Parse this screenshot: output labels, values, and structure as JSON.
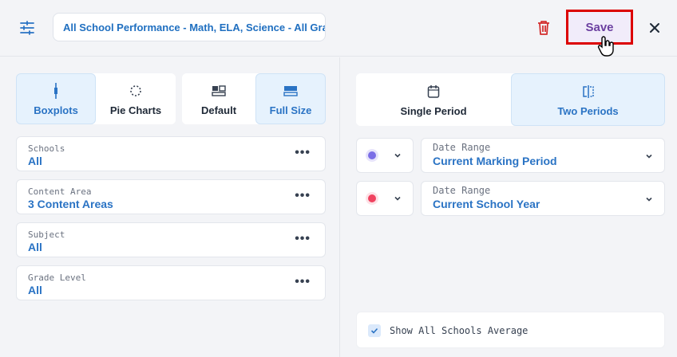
{
  "header": {
    "title_value": "All School Performance - Math, ELA, Science - All Grades",
    "save_label": "Save",
    "icons": [
      "filter-icon",
      "trash-icon",
      "close-icon",
      "hand-cursor-icon"
    ],
    "colors": {
      "save_border": "#dc0000",
      "save_text": "#6b3fa0",
      "trash": "#d32f2f"
    }
  },
  "chart_type": {
    "boxplots": "Boxplots",
    "pie_charts": "Pie Charts",
    "selected": "Boxplots"
  },
  "size_mode": {
    "default": "Default",
    "full_size": "Full Size",
    "selected": "Full Size"
  },
  "filters": [
    {
      "label": "Schools",
      "value": "All"
    },
    {
      "label": "Content Area",
      "value": "3 Content Areas"
    },
    {
      "label": "Subject",
      "value": "All"
    },
    {
      "label": "Grade Level",
      "value": "All"
    }
  ],
  "filter_menu_glyph": "•••",
  "period": {
    "single": "Single Period",
    "two": "Two Periods",
    "selected": "Two Periods"
  },
  "date_ranges": [
    {
      "label": "Date Range",
      "value": "Current Marking Period",
      "dot_color": "#7b6ee6"
    },
    {
      "label": "Date Range",
      "value": "Current School Year",
      "dot_color": "#f0425f"
    }
  ],
  "show_average": {
    "label": "Show All Schools Average",
    "checked": true
  },
  "accent": "#2a73c4"
}
